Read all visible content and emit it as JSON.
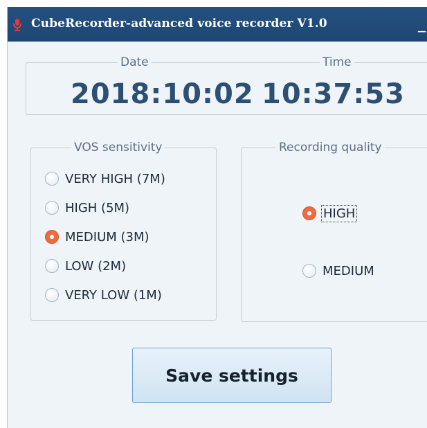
{
  "window": {
    "title": "CubeRecorder-advanced voice recorder V1.0",
    "minimize_label": "_"
  },
  "datetime": {
    "date_label": "Date",
    "time_label": "Time",
    "date_value": "2018:10:02",
    "time_value": "10:37:53"
  },
  "vos_sensitivity": {
    "legend": "VOS sensitivity",
    "options": [
      {
        "label": "VERY HIGH (7M)",
        "checked": false
      },
      {
        "label": "HIGH (5M)",
        "checked": false
      },
      {
        "label": "MEDIUM (3M)",
        "checked": true
      },
      {
        "label": "LOW (2M)",
        "checked": false
      },
      {
        "label": "VERY LOW (1M)",
        "checked": false
      }
    ]
  },
  "recording_quality": {
    "legend": "Recording quality",
    "options": [
      {
        "label": "HIGH",
        "checked": true
      },
      {
        "label": "MEDIUM",
        "checked": false
      }
    ]
  },
  "save_button_label": "Save settings",
  "colors": {
    "titlebar": "#1e4674",
    "window_bg": "#eef4f8",
    "clock_text": "#2d4f72",
    "radio_checked": "#ee6b3e",
    "button_border": "#6d9fcf"
  },
  "icons": {
    "app": "microphone-icon"
  }
}
